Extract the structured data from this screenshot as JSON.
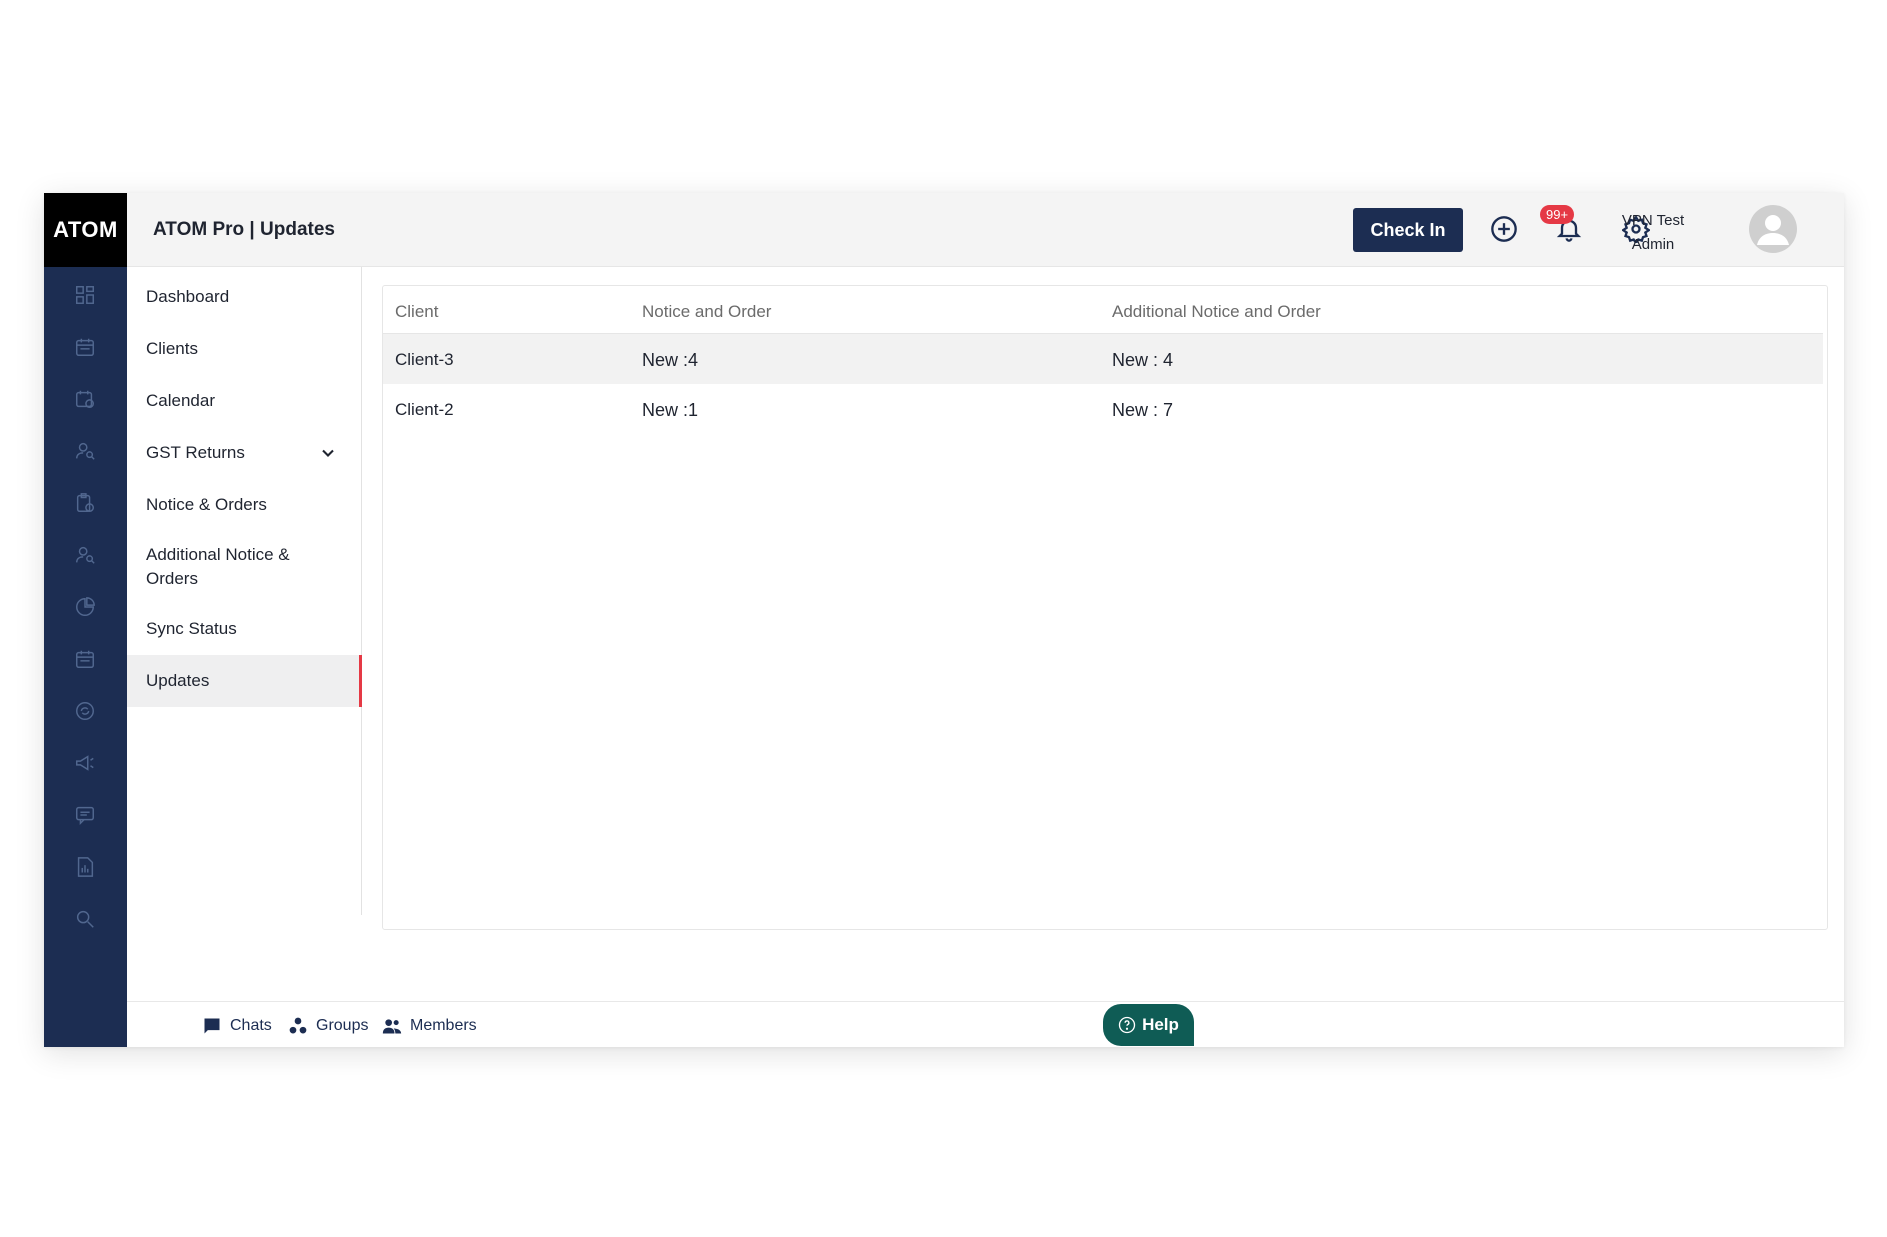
{
  "app": {
    "logo_text": "ATOM",
    "title": "ATOM Pro | Updates"
  },
  "header": {
    "check_in_label": "Check In",
    "notification_badge": "99+",
    "user_name": "VPN Test",
    "user_role": "Admin",
    "icons": [
      "add-circle-icon",
      "bell-icon",
      "gear-icon",
      "avatar-icon"
    ]
  },
  "rail": {
    "icons": [
      "dashboard-icon",
      "calendar-list-icon",
      "calendar-clock-icon",
      "user-search-icon",
      "clipboard-check-icon",
      "user-search-icon",
      "pie-chart-icon",
      "calendar-list-icon",
      "sync-doc-icon",
      "megaphone-icon",
      "chat-icon",
      "report-icon",
      "search-icon"
    ]
  },
  "sidebar": {
    "items": [
      {
        "label": "Dashboard"
      },
      {
        "label": "Clients"
      },
      {
        "label": "Calendar"
      },
      {
        "label": "GST Returns"
      },
      {
        "label": "Notice & Orders"
      },
      {
        "label": "Additional Notice & Orders"
      },
      {
        "label": "Sync Status"
      },
      {
        "label": "Updates"
      }
    ],
    "active": "Updates"
  },
  "table": {
    "columns": [
      "Client",
      "Notice and Order",
      "Additional Notice and Order"
    ],
    "rows": [
      {
        "client": "Client-3",
        "notice": "New :4",
        "additional": "New : 4"
      },
      {
        "client": "Client-2",
        "notice": "New :1",
        "additional": "New : 7"
      }
    ]
  },
  "footer": {
    "chats_label": "Chats",
    "groups_label": "Groups",
    "members_label": "Members",
    "help_label": "Help"
  },
  "colors": {
    "navy": "#1c2d52",
    "accent_red": "#e53945",
    "help_teal": "#0f5c55"
  }
}
